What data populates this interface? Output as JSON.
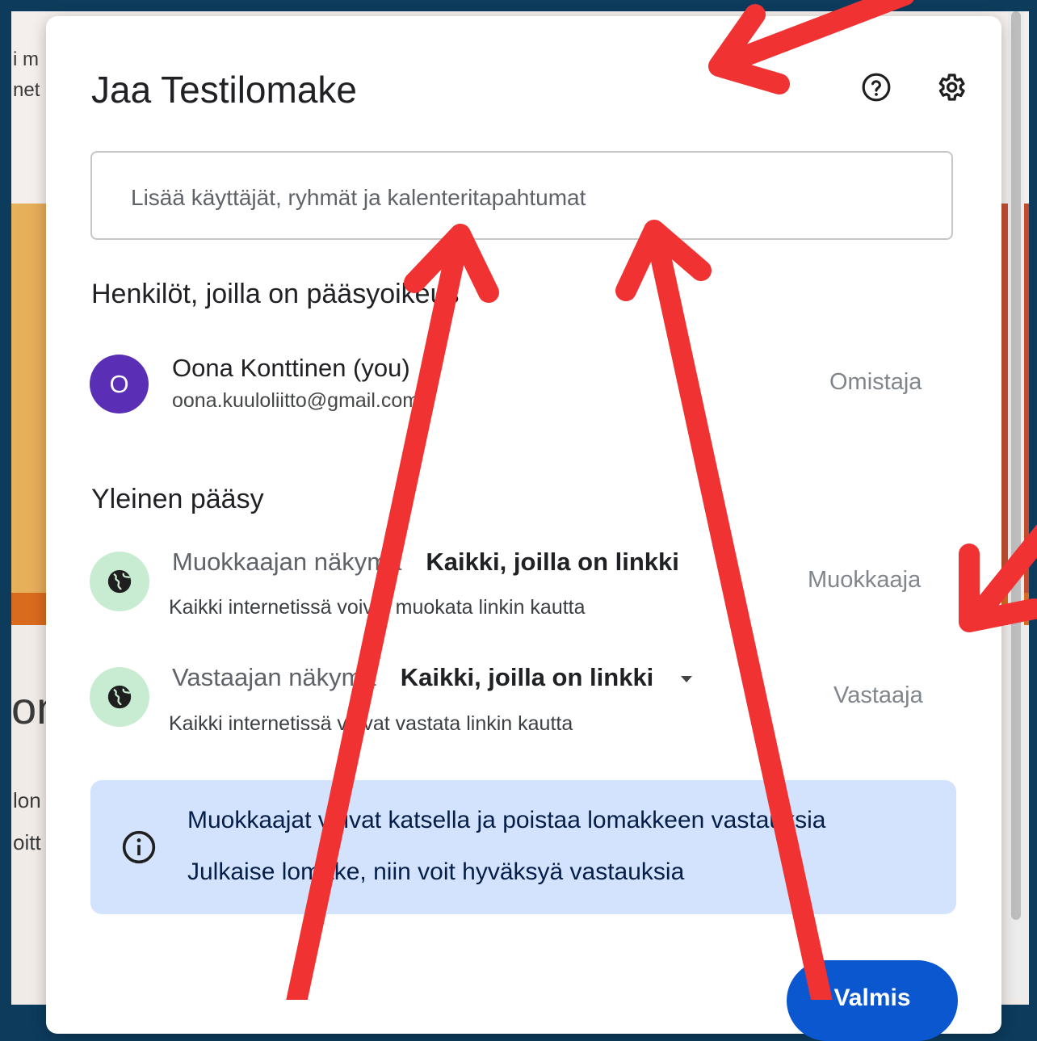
{
  "background_page": {
    "fragments": [
      "i m",
      "net",
      "on",
      "lon",
      "oitt"
    ]
  },
  "dialog": {
    "title": "Jaa Testilomake",
    "help_icon": "help-circle-icon",
    "settings_icon": "gear-icon",
    "search": {
      "placeholder": "Lisää käyttäjät, ryhmät ja kalenteritapahtumat"
    },
    "people_section": {
      "heading": "Henkilöt, joilla on pääsyoikeus",
      "users": [
        {
          "avatar_letter": "O",
          "avatar_color": "#5b2fb5",
          "name": "Oona Konttinen (you)",
          "email": "oona.kuuloliitto@gmail.com",
          "role": "Omistaja"
        }
      ]
    },
    "general_access": {
      "heading": "Yleinen pääsy",
      "entries": [
        {
          "icon": "globe-icon",
          "label": "Muokkaajan näkymä",
          "value": "Kaikki, joilla on linkki",
          "description": "Kaikki internetissä voivat muokata linkin kautta",
          "role": "Muokkaaja"
        },
        {
          "icon": "globe-icon",
          "label": "Vastaajan näkymä",
          "value": "Kaikki, joilla on linkki",
          "description": "Kaikki internetissä voivat vastata linkin kautta",
          "role": "Vastaaja"
        }
      ]
    },
    "info_box": {
      "icon": "info-icon",
      "lines": [
        "Muokkaajat voivat katsella ja poistaa lomakkeen vastauksia",
        "Julkaise lomake, niin voit hyväksyä vastauksia"
      ]
    },
    "done_button": "Valmis"
  },
  "colors": {
    "frame": "#0c3b5c",
    "accent_button": "#0b57d0",
    "info_box": "#d3e3fd",
    "globe_bg": "#c7ecd2",
    "annotation_arrow": "#f03232"
  }
}
